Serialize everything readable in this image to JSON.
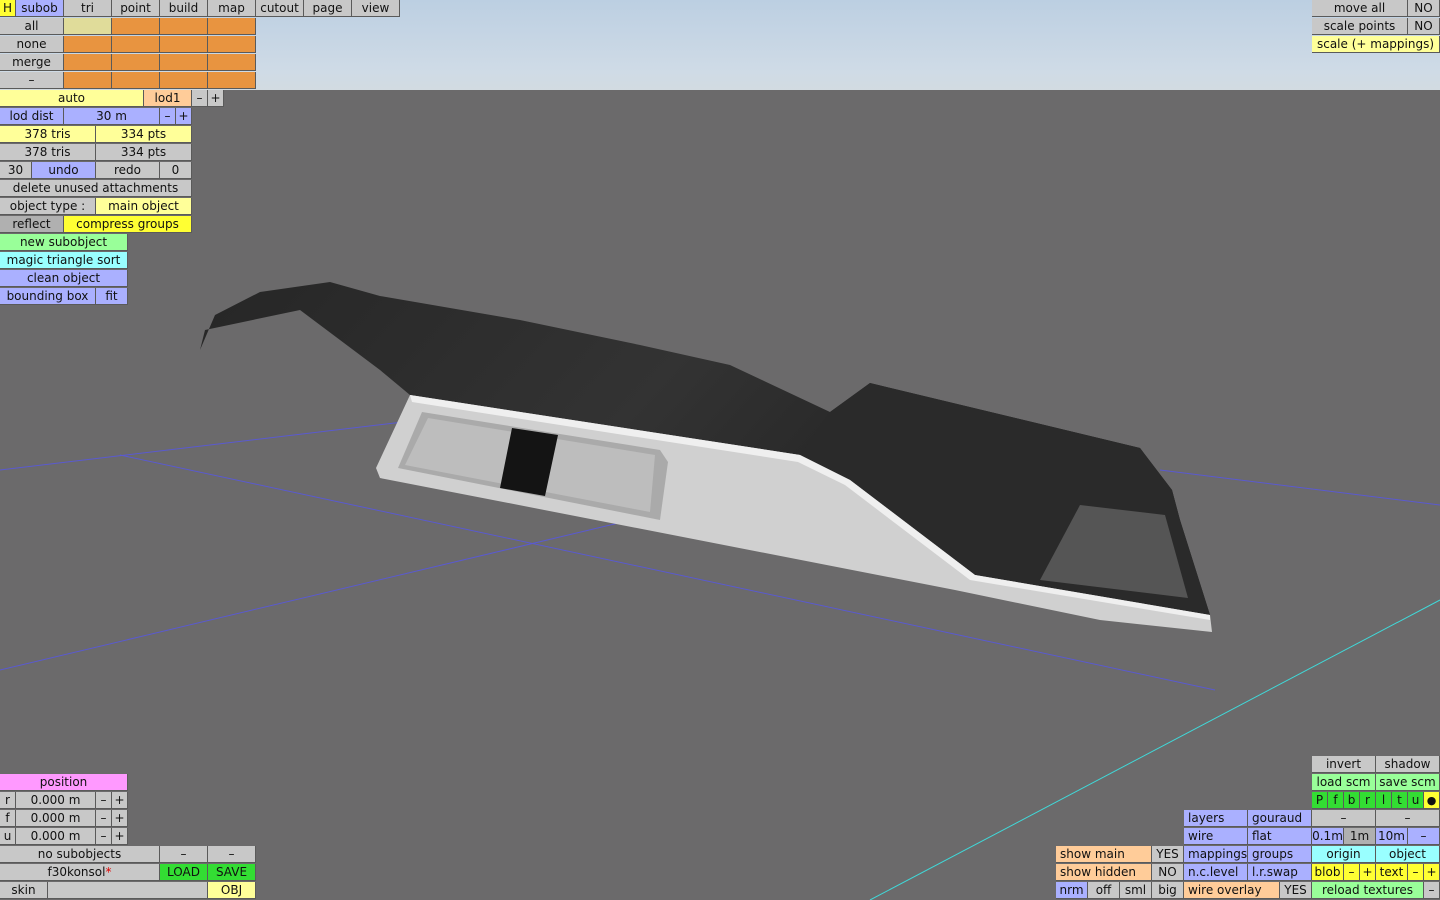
{
  "menu": {
    "h": "H",
    "tabs": [
      "subob",
      "tri",
      "point",
      "build",
      "map",
      "cutout",
      "page",
      "view"
    ]
  },
  "select": {
    "all": "all",
    "none": "none",
    "merge": "merge",
    "dash": "–"
  },
  "lod": {
    "auto": "auto",
    "level": "lod1",
    "minus": "–",
    "plus": "+",
    "dist_label": "lod dist",
    "dist_value": "30 m"
  },
  "stats": {
    "tris1": "378 tris",
    "pts1": "334 pts",
    "tris2": "378 tris",
    "pts2": "334 pts"
  },
  "history": {
    "undo_count": "30",
    "undo": "undo",
    "redo": "redo",
    "redo_count": "0"
  },
  "actions": {
    "delete_unused": "delete unused attachments",
    "object_type_label": "object type :",
    "object_type_value": "main object",
    "reflect": "reflect",
    "compress_groups": "compress groups",
    "new_subobject": "new subobject",
    "magic_sort": "magic triangle sort",
    "clean_object": "clean object",
    "bounding_box": "bounding box",
    "fit": "fit"
  },
  "top_right": {
    "move_all": "move all",
    "move_all_val": "NO",
    "scale_points": "scale points",
    "scale_points_val": "NO",
    "scale_mappings": "scale (+ mappings)"
  },
  "position": {
    "title": "position",
    "rows": [
      {
        "axis": "r",
        "value": "0.000 m"
      },
      {
        "axis": "f",
        "value": "0.000 m"
      },
      {
        "axis": "u",
        "value": "0.000 m"
      }
    ],
    "minus": "–",
    "plus": "+"
  },
  "file": {
    "no_subobjects": "no subobjects",
    "filename": "f30konsol",
    "modified_mark": "*",
    "load": "LOAD",
    "save": "SAVE",
    "skin": "skin",
    "obj": "OBJ"
  },
  "view_opts": {
    "show_main": "show main",
    "show_main_val": "YES",
    "show_hidden": "show hidden",
    "show_hidden_val": "NO",
    "nrm": "nrm",
    "off": "off",
    "sml": "sml",
    "big": "big",
    "layers": "layers",
    "gouraud": "gouraud",
    "wire": "wire",
    "flat": "flat",
    "mappings": "mappings",
    "groups": "groups",
    "nc_level": "n.c.level",
    "lr_swap": "l.r.swap",
    "wire_overlay": "wire overlay",
    "wire_overlay_val": "YES"
  },
  "right_panel": {
    "invert": "invert",
    "shadow": "shadow",
    "load_scm": "load scm",
    "save_scm": "save scm",
    "letters": [
      "P",
      "f",
      "b",
      "r",
      "l",
      "t",
      "u",
      "●"
    ],
    "grid": [
      "0.1m",
      "1m",
      "10m",
      "–"
    ],
    "origin": "origin",
    "object": "object",
    "blob": "blob",
    "text": "text",
    "reload_textures": "reload textures"
  }
}
